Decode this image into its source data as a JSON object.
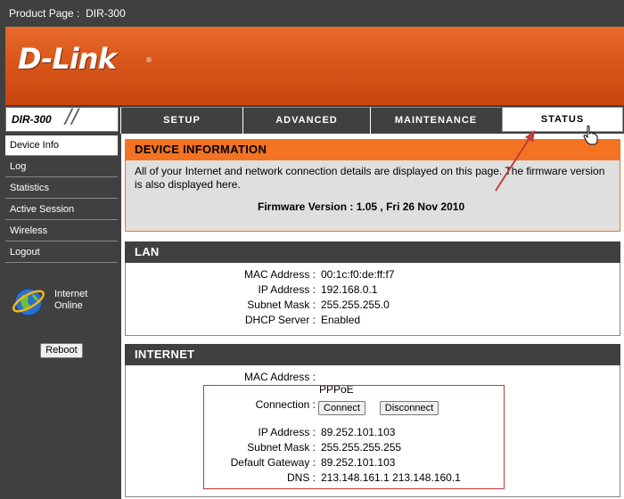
{
  "topbar": {
    "product_label": "Product Page :",
    "product_value": "DIR-300"
  },
  "brand": {
    "logo": "D-Link",
    "registered": "®",
    "model": "DIR-300"
  },
  "nav": {
    "tabs": [
      {
        "label": "SETUP"
      },
      {
        "label": "ADVANCED"
      },
      {
        "label": "MAINTENANCE"
      },
      {
        "label": "STATUS",
        "active": true
      }
    ]
  },
  "sidebar": {
    "items": [
      {
        "label": "Device Info",
        "active": true
      },
      {
        "label": "Log"
      },
      {
        "label": "Statistics"
      },
      {
        "label": "Active Session"
      },
      {
        "label": "Wireless"
      },
      {
        "label": "Logout"
      }
    ],
    "internet_status_line1": "Internet",
    "internet_status_line2": "Online",
    "globe_icon": "globe-icon",
    "reboot_label": "Reboot"
  },
  "device_info": {
    "title": "DEVICE INFORMATION",
    "description": "All of your Internet and network connection details are displayed on this page. The firmware version is also displayed here.",
    "firmware": "Firmware Version : 1.05 ,  Fri 26 Nov 2010"
  },
  "lan": {
    "title": "LAN",
    "rows": [
      {
        "label": "MAC Address :",
        "value": "00:1c:f0:de:ff:f7"
      },
      {
        "label": "IP Address :",
        "value": "192.168.0.1"
      },
      {
        "label": "Subnet Mask :",
        "value": "255.255.255.0"
      },
      {
        "label": "DHCP Server :",
        "value": "Enabled"
      }
    ]
  },
  "internet": {
    "title": "INTERNET",
    "mac_label": "MAC Address :",
    "mac_value": "",
    "connection_label": "Connection :",
    "connection_value": "PPPoE",
    "connect_label": "Connect",
    "disconnect_label": "Disconnect",
    "rows": [
      {
        "label": "IP Address :",
        "value": "89.252.101.103"
      },
      {
        "label": "Subnet Mask :",
        "value": "255.255.255.255"
      },
      {
        "label": "Default Gateway :",
        "value": "89.252.101.103"
      },
      {
        "label": "DNS :",
        "value": "213.148.161.1 213.148.160.1"
      }
    ]
  },
  "colors": {
    "orange": "#f37323",
    "banner": "#d9561a",
    "dark": "#404040",
    "annotation_red": "#c43b3b"
  }
}
